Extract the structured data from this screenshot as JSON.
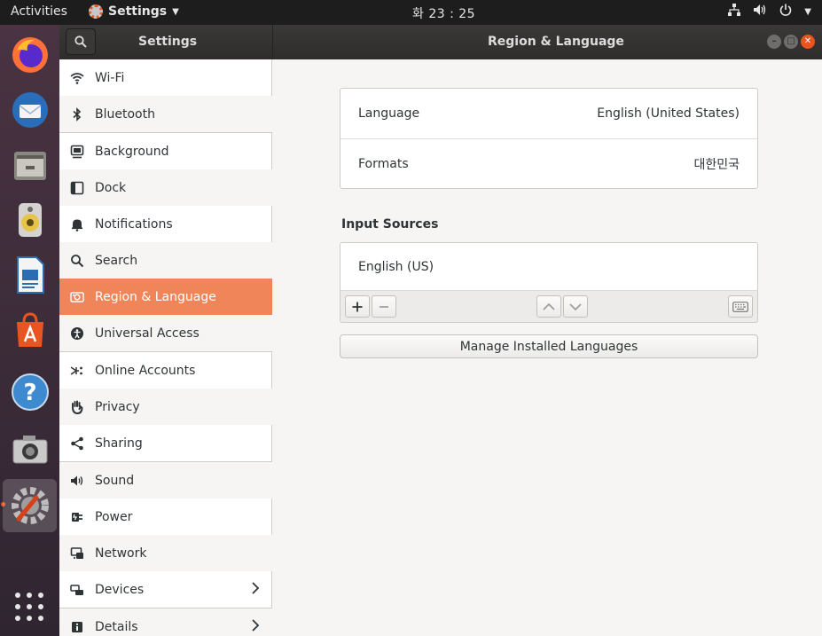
{
  "topbar": {
    "activities": "Activities",
    "app_name": "Settings",
    "clock": "화 23 : 25"
  },
  "dock": {
    "items": [
      {
        "name": "firefox",
        "color": "#ff7139"
      },
      {
        "name": "thunderbird",
        "color": "#2a6ebb"
      },
      {
        "name": "files",
        "color": "#9c9a93"
      },
      {
        "name": "rhythmbox",
        "color": "#e8c34a"
      },
      {
        "name": "libreoffice-writer",
        "color": "#2a6db0"
      },
      {
        "name": "ubuntu-software",
        "color": "#e95420"
      },
      {
        "name": "help",
        "color": "#3d8ad0"
      },
      {
        "name": "screenshot",
        "color": "#bdbdbd"
      },
      {
        "name": "settings",
        "color": "#9e9e9e"
      }
    ]
  },
  "header": {
    "left_title": "Settings",
    "main_title": "Region & Language"
  },
  "sidebar": {
    "items": [
      {
        "label": "Wi-Fi",
        "icon": "wifi-icon"
      },
      {
        "label": "Bluetooth",
        "icon": "bluetooth-icon"
      },
      {
        "label": "Background",
        "icon": "background-icon"
      },
      {
        "label": "Dock",
        "icon": "dock-icon"
      },
      {
        "label": "Notifications",
        "icon": "bell-icon"
      },
      {
        "label": "Search",
        "icon": "search-icon"
      },
      {
        "label": "Region & Language",
        "icon": "region-icon",
        "selected": true
      },
      {
        "label": "Universal Access",
        "icon": "accessibility-icon"
      },
      {
        "label": "Online Accounts",
        "icon": "online-accounts-icon"
      },
      {
        "label": "Privacy",
        "icon": "hand-icon"
      },
      {
        "label": "Sharing",
        "icon": "share-icon"
      },
      {
        "label": "Sound",
        "icon": "speaker-icon"
      },
      {
        "label": "Power",
        "icon": "power-plug-icon"
      },
      {
        "label": "Network",
        "icon": "network-icon"
      },
      {
        "label": "Devices",
        "icon": "devices-icon",
        "has_submenu": true
      },
      {
        "label": "Details",
        "icon": "info-icon",
        "has_submenu": true
      }
    ]
  },
  "main": {
    "language_label": "Language",
    "language_value": "English (United States)",
    "formats_label": "Formats",
    "formats_value": "대한민국",
    "input_sources_title": "Input Sources",
    "input_sources": [
      "English (US)"
    ],
    "manage_button": "Manage Installed Languages"
  },
  "colors": {
    "accent": "#e95420",
    "selected_row": "#f0855a"
  }
}
